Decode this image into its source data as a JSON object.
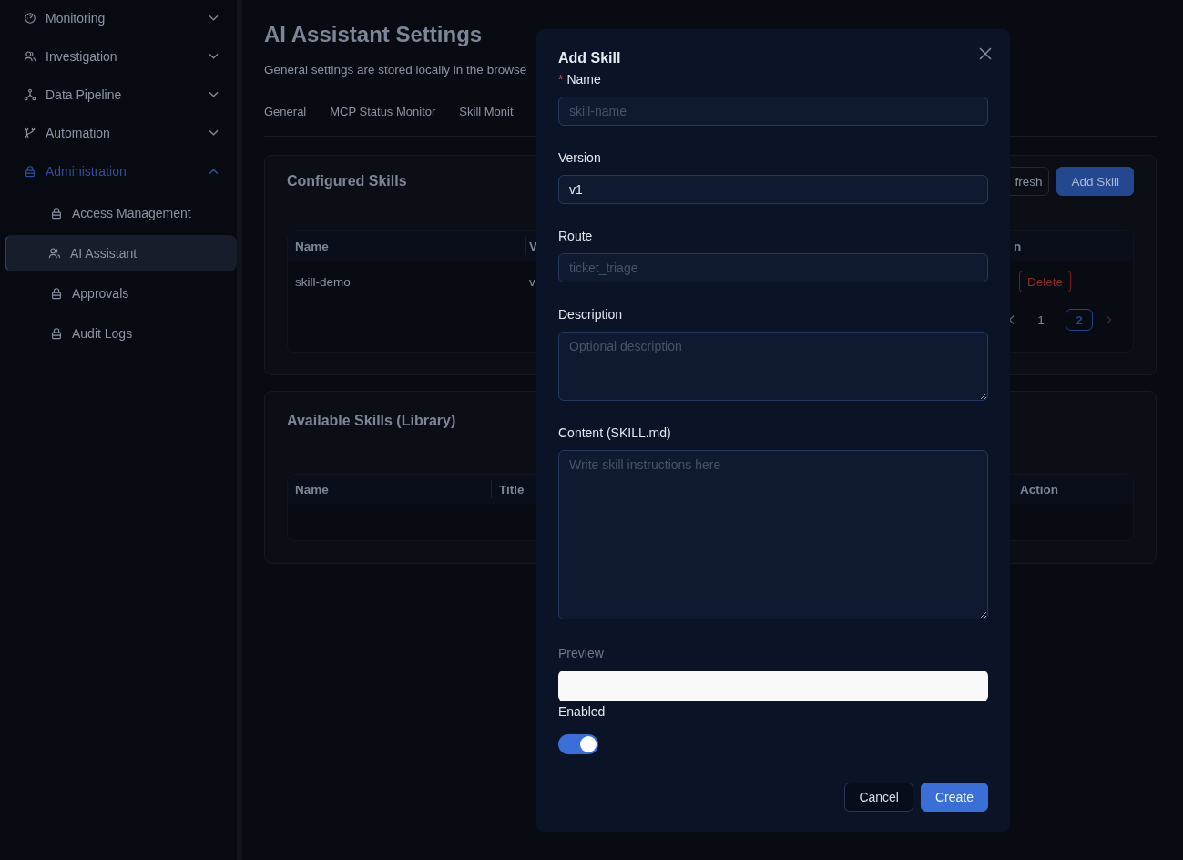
{
  "sidebar": {
    "items": [
      {
        "label": "Monitoring",
        "expanded": false,
        "active": false
      },
      {
        "label": "Investigation",
        "expanded": false,
        "active": false
      },
      {
        "label": "Data Pipeline",
        "expanded": false,
        "active": false
      },
      {
        "label": "Automation",
        "expanded": false,
        "active": false
      },
      {
        "label": "Administration",
        "expanded": true,
        "active": true,
        "children": [
          {
            "label": "Access Management",
            "selected": false
          },
          {
            "label": "AI Assistant",
            "selected": true
          },
          {
            "label": "Approvals",
            "selected": false
          },
          {
            "label": "Audit Logs",
            "selected": false
          }
        ]
      }
    ]
  },
  "page": {
    "title": "AI Assistant Settings",
    "subtitle": "General settings are stored locally in the browse",
    "tabs": [
      {
        "label": "General",
        "selected": false
      },
      {
        "label": "MCP Status Monitor",
        "selected": false
      },
      {
        "label": "Skill Monit",
        "selected": false
      }
    ]
  },
  "configured_skills": {
    "title": "Configured Skills",
    "buttons": [
      {
        "label": "fresh",
        "kind": "default"
      },
      {
        "label": "Add Skill",
        "kind": "primary"
      }
    ],
    "columns": [
      "Name",
      "V",
      "n"
    ],
    "rows": [
      {
        "cells": [
          "skill-demo",
          "v"
        ],
        "action": "Delete"
      }
    ],
    "pagination": {
      "pages": [
        {
          "label": "1",
          "selected": false
        },
        {
          "label": "2",
          "selected": true
        }
      ],
      "next_disabled": true
    }
  },
  "library": {
    "title": "Available Skills (Library)",
    "columns": [
      "Name",
      "Title",
      "Action"
    ]
  },
  "dialog": {
    "title": "Add Skill",
    "fields": [
      {
        "kind": "input",
        "label": "Name",
        "marker": "*",
        "placeholder": "skill-name"
      },
      {
        "kind": "input",
        "label": "Version",
        "value": "v1"
      },
      {
        "kind": "input",
        "label": "Route",
        "placeholder": "ticket_triage"
      },
      {
        "kind": "textarea",
        "label": "Description",
        "placeholder": "Optional description"
      },
      {
        "kind": "editor",
        "label": "Content (SKILL.md)",
        "placeholder": "Write skill instructions here"
      },
      {
        "kind": "preview",
        "label": "Preview"
      },
      {
        "kind": "switch",
        "label": "Enabled",
        "on": true
      }
    ],
    "buttons": [
      {
        "label": "Cancel",
        "kind": "default"
      },
      {
        "label": "Create",
        "kind": "primary"
      }
    ]
  }
}
